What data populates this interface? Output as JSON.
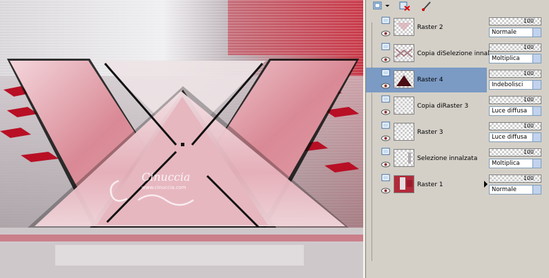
{
  "layers": [
    {
      "name": "Raster 2",
      "opacity": "100",
      "blend": "Normale",
      "selected": false
    },
    {
      "name": "Copia diSelezione innal",
      "opacity": "100",
      "blend": "Moltiplica",
      "selected": false
    },
    {
      "name": "Raster 4",
      "opacity": "100",
      "blend": "Indebolisci",
      "selected": true
    },
    {
      "name": "Copia diRaster 3",
      "opacity": "100",
      "blend": "Luce diffusa",
      "selected": false
    },
    {
      "name": "Raster 3",
      "opacity": "100",
      "blend": "Luce diffusa",
      "selected": false
    },
    {
      "name": "Selezione innalzata",
      "opacity": "100",
      "blend": "Moltiplica",
      "selected": false
    },
    {
      "name": "Raster 1",
      "opacity": "100",
      "blend": "Normale",
      "selected": false
    }
  ],
  "watermark": {
    "name": "Cinuccia",
    "site": "www.cinuccia.com"
  },
  "colors": {
    "selection": "#7b9ac4",
    "panel": "#d4d0c8",
    "accent_red": "#c8102e"
  }
}
